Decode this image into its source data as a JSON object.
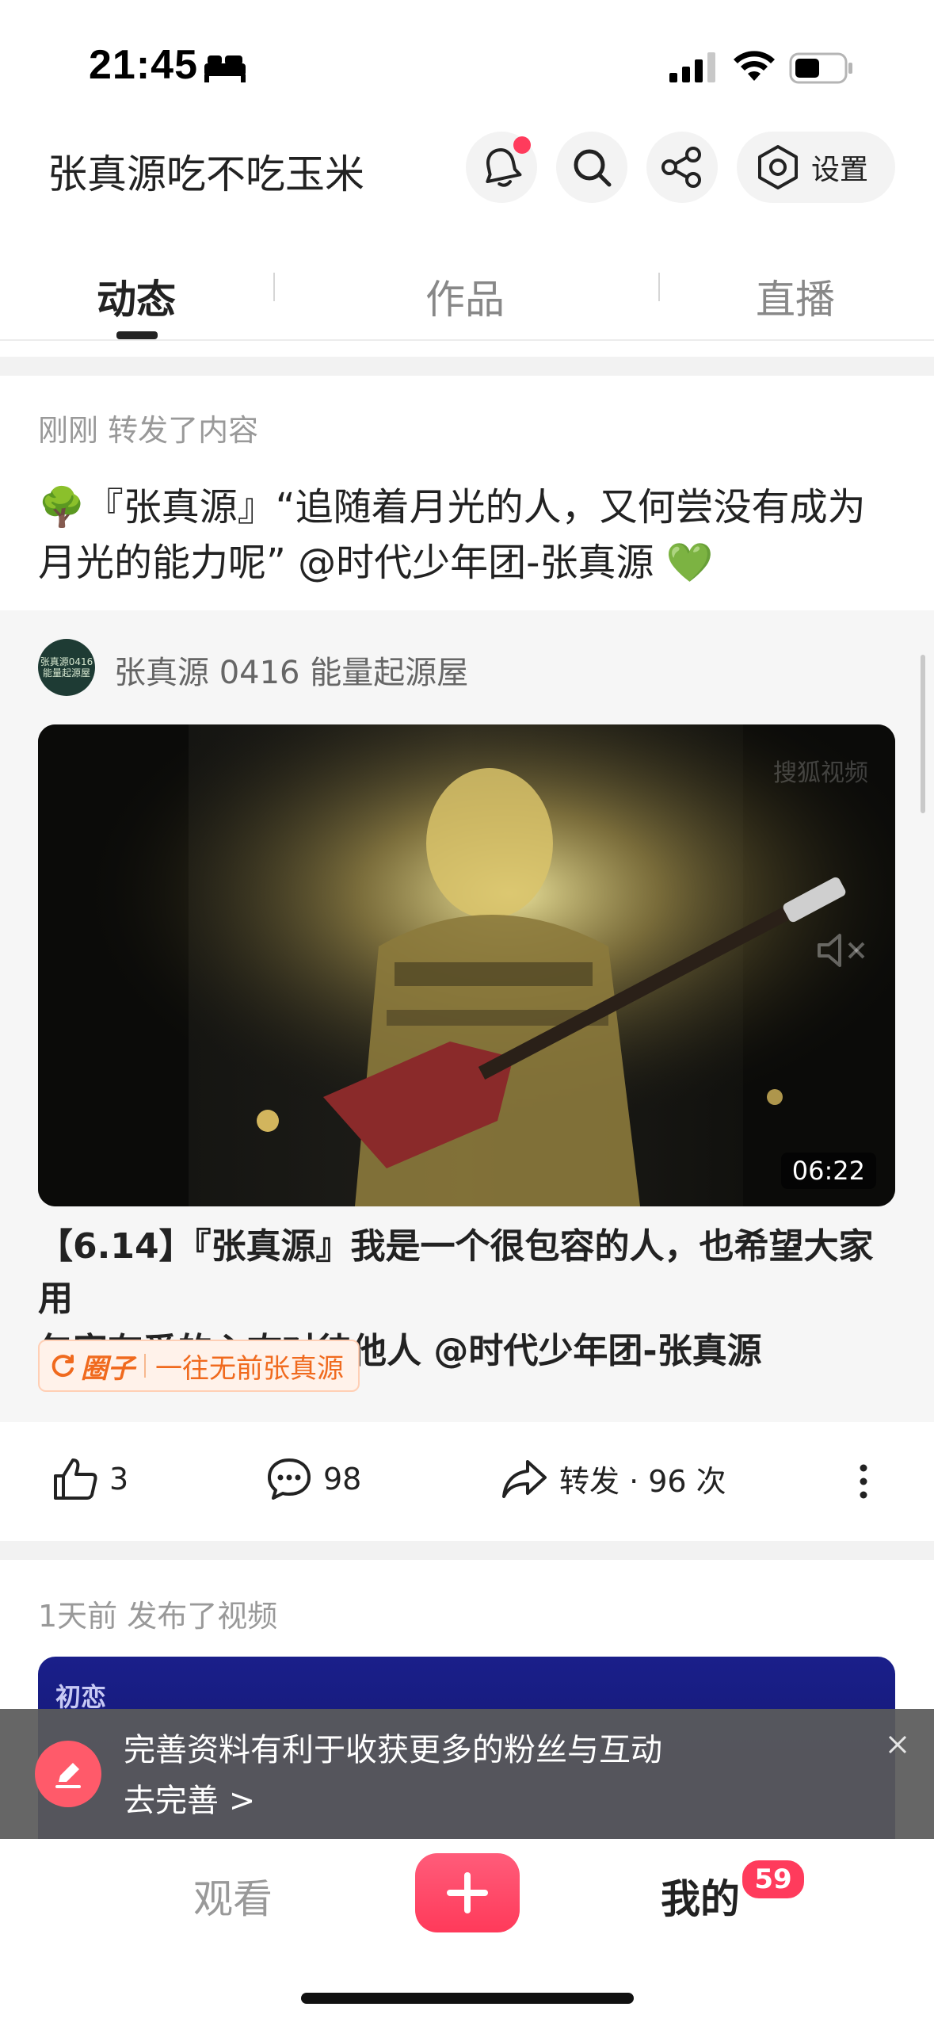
{
  "status_bar": {
    "time": "21:45"
  },
  "header": {
    "title": "张真源吃不吃玉米",
    "settings_label": "设置"
  },
  "tabs": [
    {
      "label": "动态",
      "active": true
    },
    {
      "label": "作品",
      "active": false
    },
    {
      "label": "直播",
      "active": false
    }
  ],
  "post1": {
    "meta": "刚刚 转发了内容",
    "text_line1": "🌳『张真源』“追随着月光的人，又何尝没有成为",
    "text_line2": "月光的能力呢” @时代少年团-张真源 💚",
    "source": {
      "name": "张真源 0416 能量起源屋",
      "avatar_text": "张真源0416 能量起源屋"
    },
    "video": {
      "duration": "06:22",
      "watermark": "搜狐视频"
    },
    "video_title_line1": "【6.14】『张真源』我是一个很包容的人，也希望大家用",
    "video_title_line2": "包容有爱的心态对待他人 @时代少年团-张真源",
    "circle_tag": {
      "label": "圈子",
      "name": "一往无前张真源"
    },
    "actions": {
      "likes": "3",
      "comments": "98",
      "repost": "转发 · 96 次"
    }
  },
  "post2": {
    "meta": "1天前 发布了视频",
    "video_caption": "初恋"
  },
  "toast": {
    "message": "完善资料有利于收获更多的粉丝与互动",
    "action": "去完善 >"
  },
  "tabbar": {
    "watch": "观看",
    "mine": "我的",
    "badge": "59"
  },
  "colors": {
    "accent": "#ff3b5c",
    "tag_orange": "#f06a1e"
  }
}
